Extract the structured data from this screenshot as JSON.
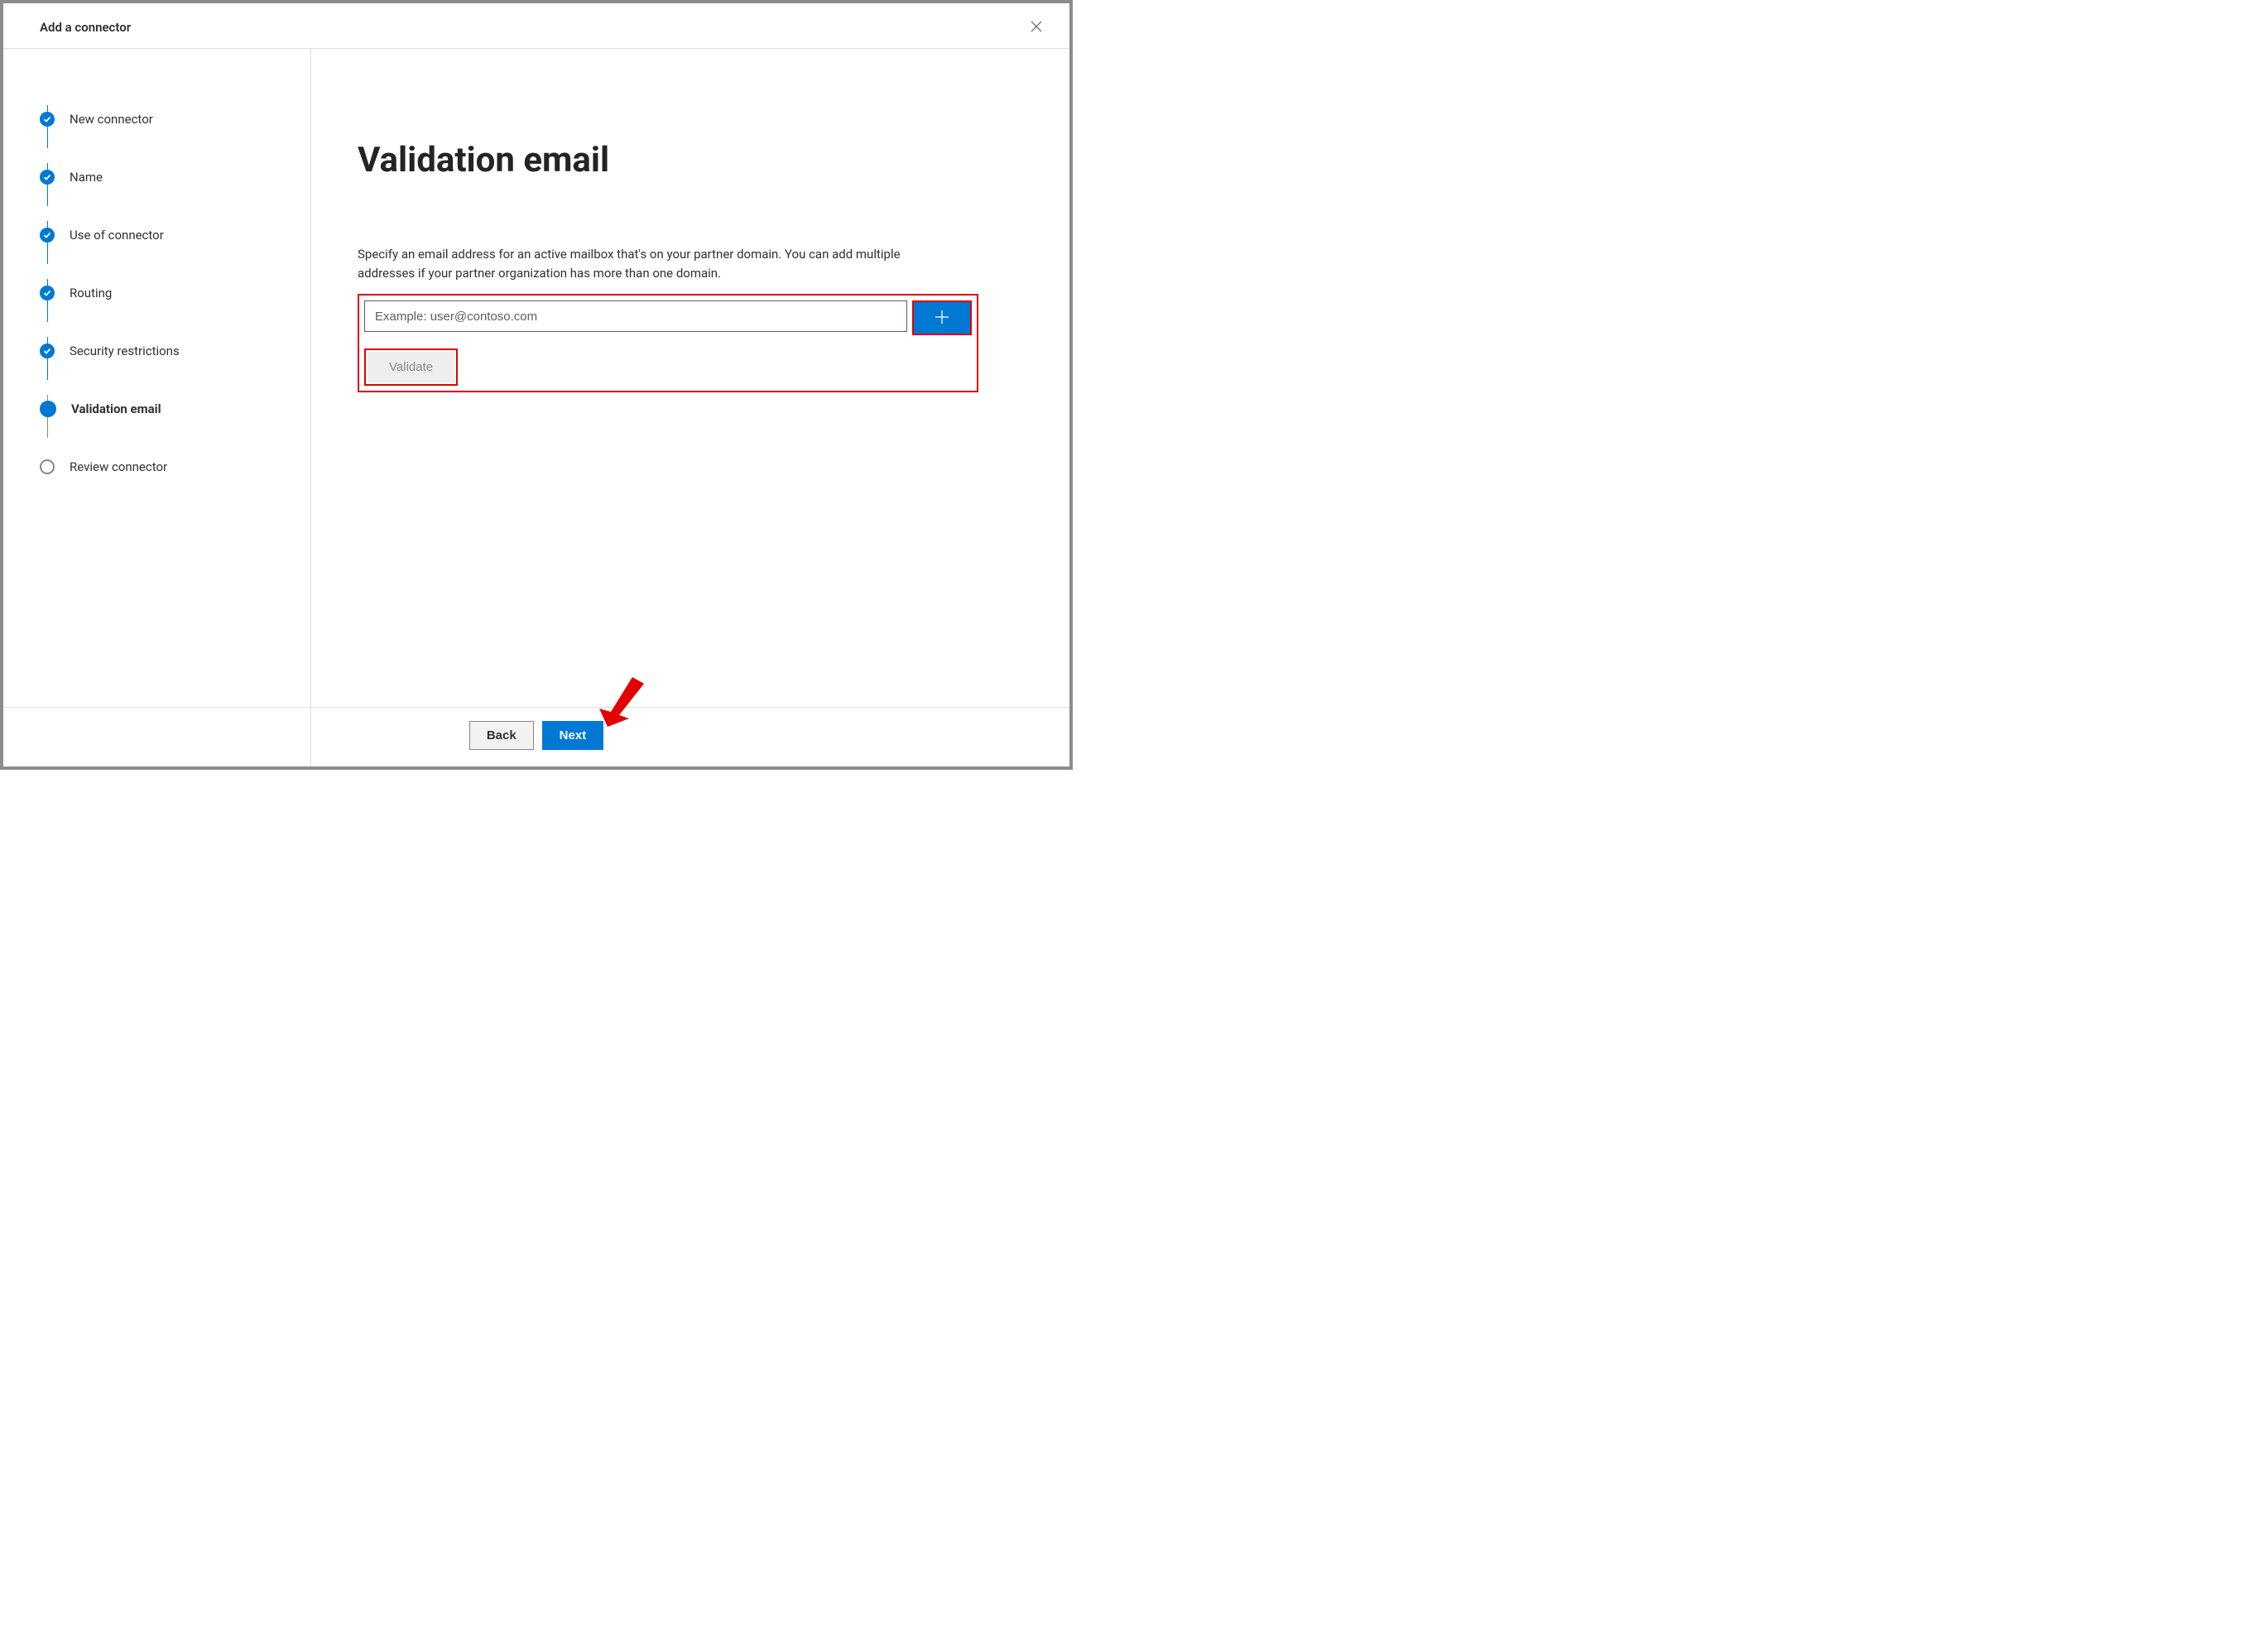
{
  "header": {
    "title": "Add a connector"
  },
  "sidebar": {
    "steps": [
      {
        "label": "New connector",
        "state": "complete"
      },
      {
        "label": "Name",
        "state": "complete"
      },
      {
        "label": "Use of connector",
        "state": "complete"
      },
      {
        "label": "Routing",
        "state": "complete"
      },
      {
        "label": "Security restrictions",
        "state": "complete"
      },
      {
        "label": "Validation email",
        "state": "current"
      },
      {
        "label": "Review connector",
        "state": "upcoming"
      }
    ]
  },
  "main": {
    "title": "Validation email",
    "description": "Specify an email address for an active mailbox that's on your partner domain. You can add multiple addresses if your partner organization has more than one domain.",
    "email_placeholder": "Example: user@contoso.com",
    "email_value": "",
    "validate_label": "Validate"
  },
  "footer": {
    "back_label": "Back",
    "next_label": "Next"
  }
}
